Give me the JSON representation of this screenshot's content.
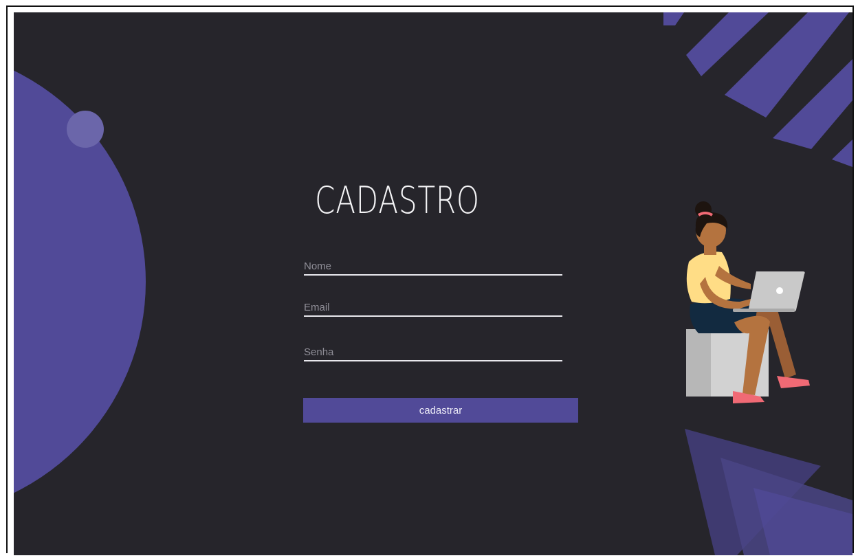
{
  "form": {
    "title": "CADASTRO",
    "fields": [
      {
        "name": "nome",
        "placeholder": "Nome",
        "value": ""
      },
      {
        "name": "email",
        "placeholder": "Email",
        "value": ""
      },
      {
        "name": "senha",
        "placeholder": "Senha",
        "value": ""
      }
    ],
    "submit_label": "cadastrar"
  },
  "theme": {
    "background": "#26252b",
    "accent": "#514a98",
    "text": "#f4f4f6"
  },
  "illustration": {
    "subject": "woman-with-laptop"
  }
}
